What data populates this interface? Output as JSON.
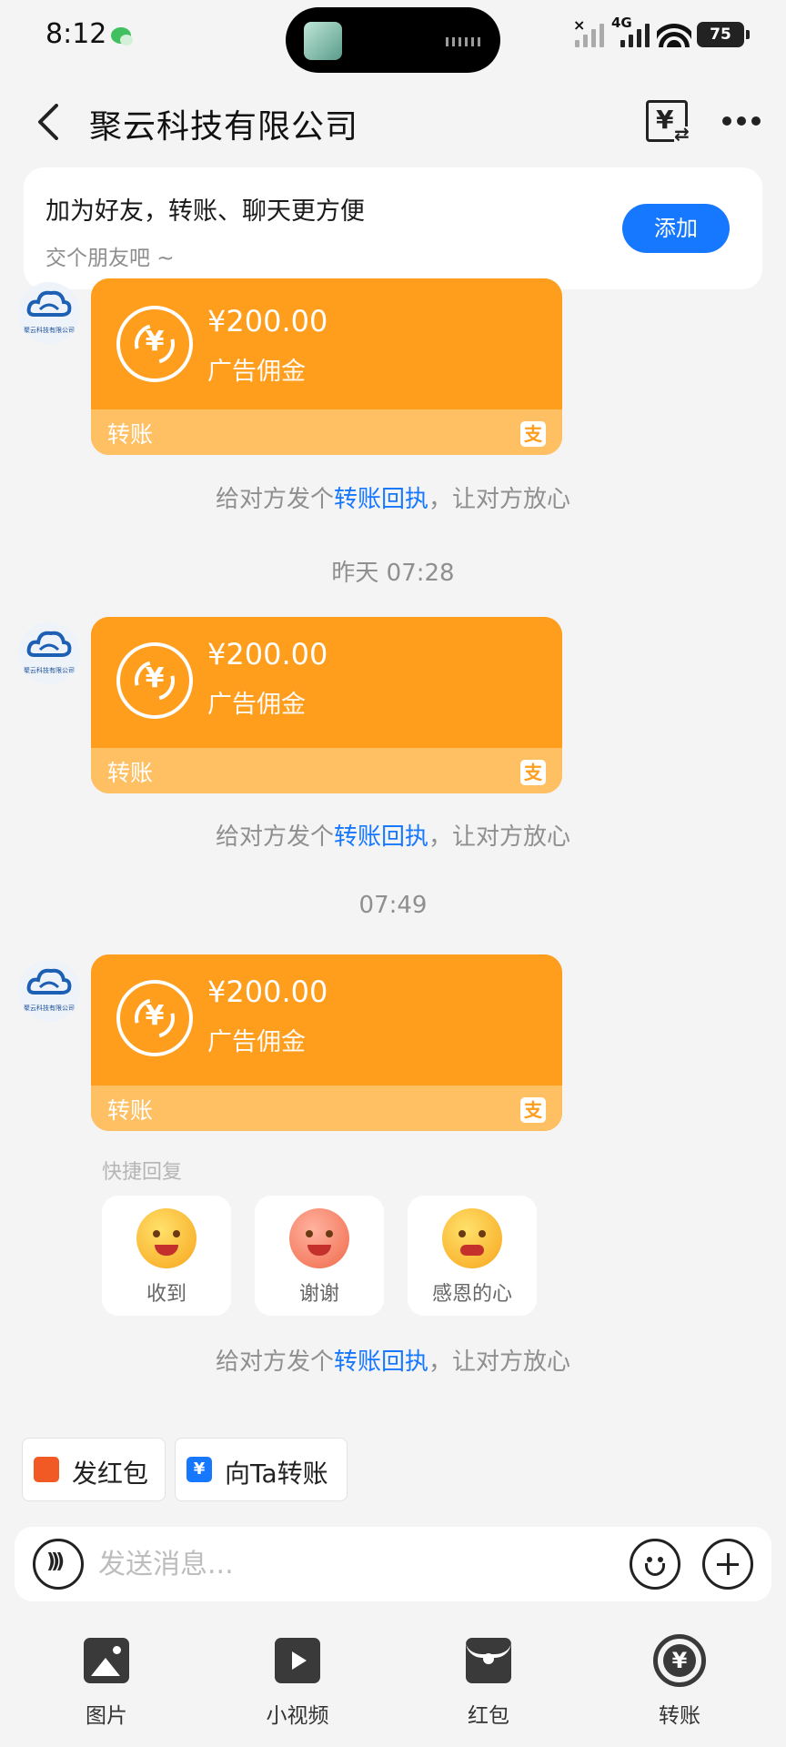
{
  "status_bar": {
    "time": "8:12",
    "network": "4G",
    "battery": "75"
  },
  "header": {
    "title": "聚云科技有限公司"
  },
  "friend_card": {
    "title": "加为好友，转账、聊天更方便",
    "subtitle": "交个朋友吧 ~",
    "add_label": "添加"
  },
  "avatar_caption": "聚云科技有限公司",
  "messages": [
    {
      "amount": "¥200.00",
      "memo": "广告佣金",
      "label": "转账"
    },
    {
      "amount": "¥200.00",
      "memo": "广告佣金",
      "label": "转账"
    },
    {
      "amount": "¥200.00",
      "memo": "广告佣金",
      "label": "转账"
    }
  ],
  "receipt": {
    "prefix": "给对方发个",
    "link": "转账回执",
    "suffix": "，让对方放心"
  },
  "timestamps": [
    "昨天 07:28",
    "07:49"
  ],
  "quick_reply": {
    "title": "快捷回复",
    "items": [
      {
        "label": "收到"
      },
      {
        "label": "谢谢"
      },
      {
        "label": "感恩的心"
      }
    ]
  },
  "actions": {
    "red_packet": "发红包",
    "transfer": "向Ta转账"
  },
  "input": {
    "placeholder": "发送消息..."
  },
  "toolbar": {
    "photo": "图片",
    "video": "小视频",
    "red_packet": "红包",
    "transfer": "转账"
  },
  "colors": {
    "accent": "#1677ff",
    "transfer_orange": "#ff9d1c",
    "transfer_light": "#ffbf63"
  },
  "icons": [
    "back-icon",
    "bill-icon",
    "more-icon",
    "coin-icon",
    "alipay-icon",
    "voice-icon",
    "smile-icon",
    "plus-icon",
    "photo-icon",
    "video-icon",
    "red-packet-icon",
    "transfer-icon"
  ]
}
